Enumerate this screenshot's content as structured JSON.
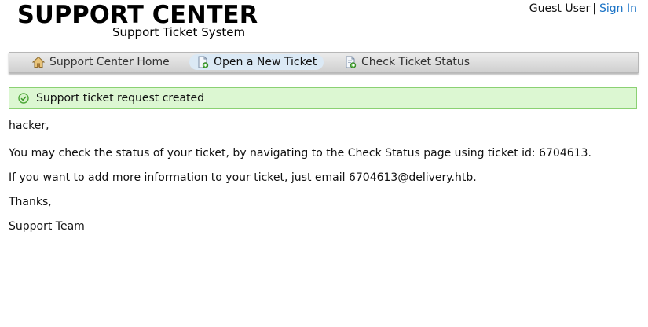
{
  "header": {
    "logo_title": "SUPPORT CENTER",
    "logo_subtitle": "Support Ticket System",
    "user_name": "Guest User",
    "separator": "|",
    "sign_in_label": "Sign In"
  },
  "nav": {
    "items": [
      {
        "label": "Support Center Home",
        "icon": "home-icon",
        "active": false
      },
      {
        "label": "Open a New Ticket",
        "icon": "new-ticket-icon",
        "active": true
      },
      {
        "label": "Check Ticket Status",
        "icon": "ticket-status-icon",
        "active": false
      }
    ]
  },
  "notice": {
    "text": "Support ticket request created",
    "icon": "check-circle-icon"
  },
  "message": {
    "greeting": "hacker,",
    "line1": "You may check the status of your ticket, by navigating to the Check Status page using ticket id: 6704613.",
    "line2": "If you want to add more information to your ticket, just email 6704613@delivery.htb.",
    "closing": "Thanks,",
    "signature": "Support Team"
  },
  "colors": {
    "link": "#1a73c6",
    "notice_bg": "#dcf7d2",
    "notice_border": "#8bd173",
    "active_tab": "#dbe9f5"
  }
}
